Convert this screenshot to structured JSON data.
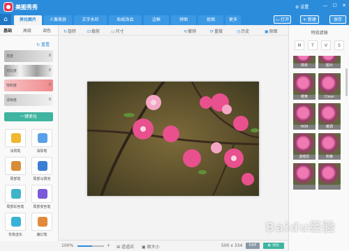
{
  "app": {
    "name": "美图秀秀",
    "settings_label": "设置",
    "window_buttons": [
      "—",
      "☐",
      "✕"
    ]
  },
  "nav": {
    "tabs": [
      "美化图片",
      "人像美容",
      "文字水印",
      "贴纸饰品",
      "边框",
      "拼图",
      "抠图",
      "更多"
    ],
    "active_index": 0,
    "actions": [
      "打开",
      "+ 新建",
      "保存"
    ]
  },
  "left": {
    "subtabs": [
      "基础",
      "高级",
      "调色"
    ],
    "reset_label": "重置",
    "sliders": [
      {
        "label": "亮度",
        "value": "0",
        "color": "#cfcfcf"
      },
      {
        "label": "对比度",
        "value": "0",
        "color": "#bdbdbd"
      },
      {
        "label": "饱和度",
        "value": "0",
        "color": "#f4a9ab"
      },
      {
        "label": "清晰度",
        "value": "0",
        "color": "#e0e0e0"
      }
    ],
    "one_key_label": "一键美化",
    "tools": [
      {
        "label": "涂鸦笔",
        "color": "#f0b830"
      },
      {
        "label": "消除笔",
        "color": "#5aa0e6"
      },
      {
        "label": "局部笔",
        "color": "#d98d3a"
      },
      {
        "label": "局部马赛克",
        "color": "#3b7fd4"
      },
      {
        "label": "局部彩色笔",
        "color": "#3fb4c8"
      },
      {
        "label": "局部变色笔",
        "color": "#7b5ad9"
      },
      {
        "label": "背景虚化",
        "color": "#38b2d6"
      },
      {
        "label": "魔幻笔",
        "color": "#e08a3a"
      }
    ]
  },
  "toolbar": {
    "items": [
      {
        "icon": "↻",
        "label": "旋转"
      },
      {
        "icon": "⊡",
        "label": "裁剪"
      },
      {
        "icon": "▭",
        "label": "尺寸"
      },
      {
        "icon": "⟲",
        "label": "撤销"
      },
      {
        "icon": "⟳",
        "label": "重做"
      },
      {
        "icon": "◷",
        "label": "历史"
      },
      {
        "icon": "▣",
        "label": "原图"
      }
    ]
  },
  "status": {
    "zoom": "100%",
    "zoom_fraction": 0.55,
    "fit_label": "适适应",
    "actual_size_label": "原大小",
    "dimensions": "500 x 334",
    "exif_label": "EXIF",
    "compare_label": "对比"
  },
  "right": {
    "title": "特效滤镜",
    "tabs": [
      "M",
      "T",
      "V",
      "S"
    ],
    "filters": [
      "简单",
      "胶片",
      "暖黄",
      "Clean",
      "HDR",
      "暖调",
      "蓝暗尼",
      "粉嫩",
      "",
      ""
    ]
  },
  "watermark": {
    "text": "Baidu经验",
    "sub": "jingyan.baidu.com"
  }
}
